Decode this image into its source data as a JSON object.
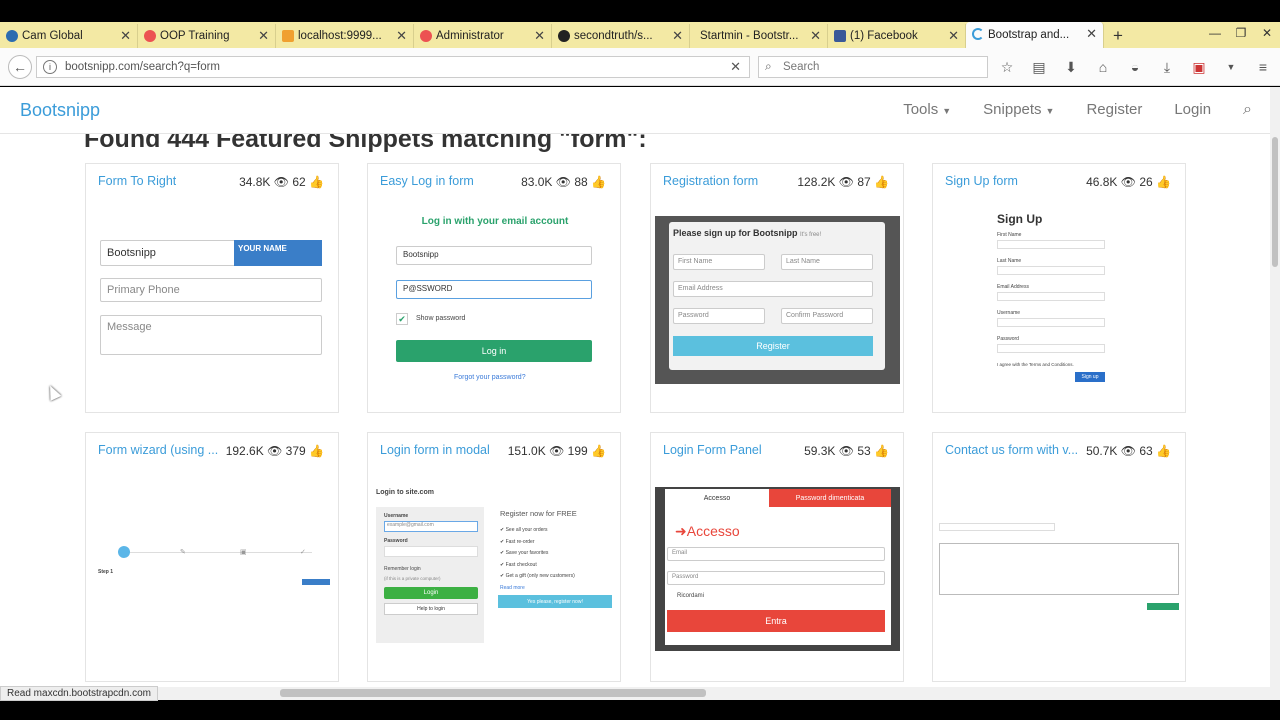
{
  "browser": {
    "tabs": [
      {
        "title": "Cam Global",
        "icon": "globe-icon",
        "color": "#2b6cb0"
      },
      {
        "title": "OOP Training",
        "icon": "udemy-icon",
        "color": "#ec5252"
      },
      {
        "title": "localhost:9999...",
        "icon": "phpmyadmin-icon",
        "color": "#f0a030"
      },
      {
        "title": "Administrator",
        "icon": "udemy-icon",
        "color": "#ec5252"
      },
      {
        "title": "secondtruth/s...",
        "icon": "github-icon",
        "color": "#222222"
      },
      {
        "title": "Startmin - Bootstr...",
        "icon": "",
        "color": ""
      },
      {
        "title": "(1) Facebook",
        "icon": "facebook-icon",
        "color": "#3b5998"
      },
      {
        "title": "Bootstrap and...",
        "icon": "loading-icon",
        "color": "#3b9cd9"
      }
    ],
    "url": "bootsnipp.com/search?q=form",
    "search_placeholder": "Search",
    "status": "Read maxcdn.bootstrapcdn.com"
  },
  "site": {
    "brand": "Bootsnipp",
    "nav": {
      "tools": "Tools",
      "snippets": "Snippets",
      "register": "Register",
      "login": "Login"
    },
    "heading": "Found 444 Featured Snippets matching \"form\":"
  },
  "cards": [
    {
      "title": "Form To Right",
      "views": "34.8K",
      "likes": "62"
    },
    {
      "title": "Easy Log in form",
      "views": "83.0K",
      "likes": "88"
    },
    {
      "title": "Registration form",
      "views": "128.2K",
      "likes": "87"
    },
    {
      "title": "Sign Up form",
      "views": "46.8K",
      "likes": "26"
    },
    {
      "title": "Form wizard (using ...",
      "views": "192.6K",
      "likes": "379"
    },
    {
      "title": "Login form in modal",
      "views": "151.0K",
      "likes": "199"
    },
    {
      "title": "Login Form Panel",
      "views": "59.3K",
      "likes": "53"
    },
    {
      "title": "Contact us form with v...",
      "views": "50.7K",
      "likes": "63"
    }
  ],
  "previews": {
    "form_to_right": {
      "name_value": "Bootsnipp",
      "name_label": "YOUR NAME",
      "phone_placeholder": "Primary Phone",
      "message_placeholder": "Message"
    },
    "easy_login": {
      "header": "Log in with your email account",
      "username": "Bootsnipp",
      "password": "P@SSWORD",
      "show_password": "Show password",
      "login": "Log in",
      "forgot": "Forgot your password?"
    },
    "registration": {
      "header": "Please sign up for Bootsnipp",
      "header_note": "It's free!",
      "first": "First Name",
      "last": "Last Name",
      "email": "Email Address",
      "password": "Password",
      "confirm": "Confirm Password",
      "register": "Register"
    },
    "signup": {
      "title": "Sign Up",
      "first": "First Name",
      "last": "Last Name",
      "email": "Email Address",
      "username": "Username",
      "password": "Password",
      "agree": "I agree with the Terms and Conditions.",
      "button": "Sign up"
    },
    "wizard": {
      "step": "Step 1"
    },
    "modal": {
      "title": "Login to site.com",
      "username": "Username",
      "username_value": "example@gmail.com",
      "password": "Password",
      "remember": "Remember login",
      "private": "(if this is a private computer)",
      "login": "Login",
      "help": "Help to login",
      "register_title": "Register now for FREE",
      "items": [
        "See all your orders",
        "Fast re-order",
        "Save your favorites",
        "Fast checkout",
        "Get a gift (only new customers)"
      ],
      "read_more": "Read more",
      "register_btn": "Yes please, register now!"
    },
    "panel": {
      "tab1": "Accesso",
      "tab2": "Password dimenticata",
      "title": "Accesso",
      "email": "Email",
      "password": "Password",
      "remember": "Ricordami",
      "submit": "Entra"
    }
  },
  "colors": {
    "brand": "#3b9cd9",
    "green": "#2aa26c",
    "red": "#e8463b",
    "blue_btn": "#5bc0de"
  }
}
